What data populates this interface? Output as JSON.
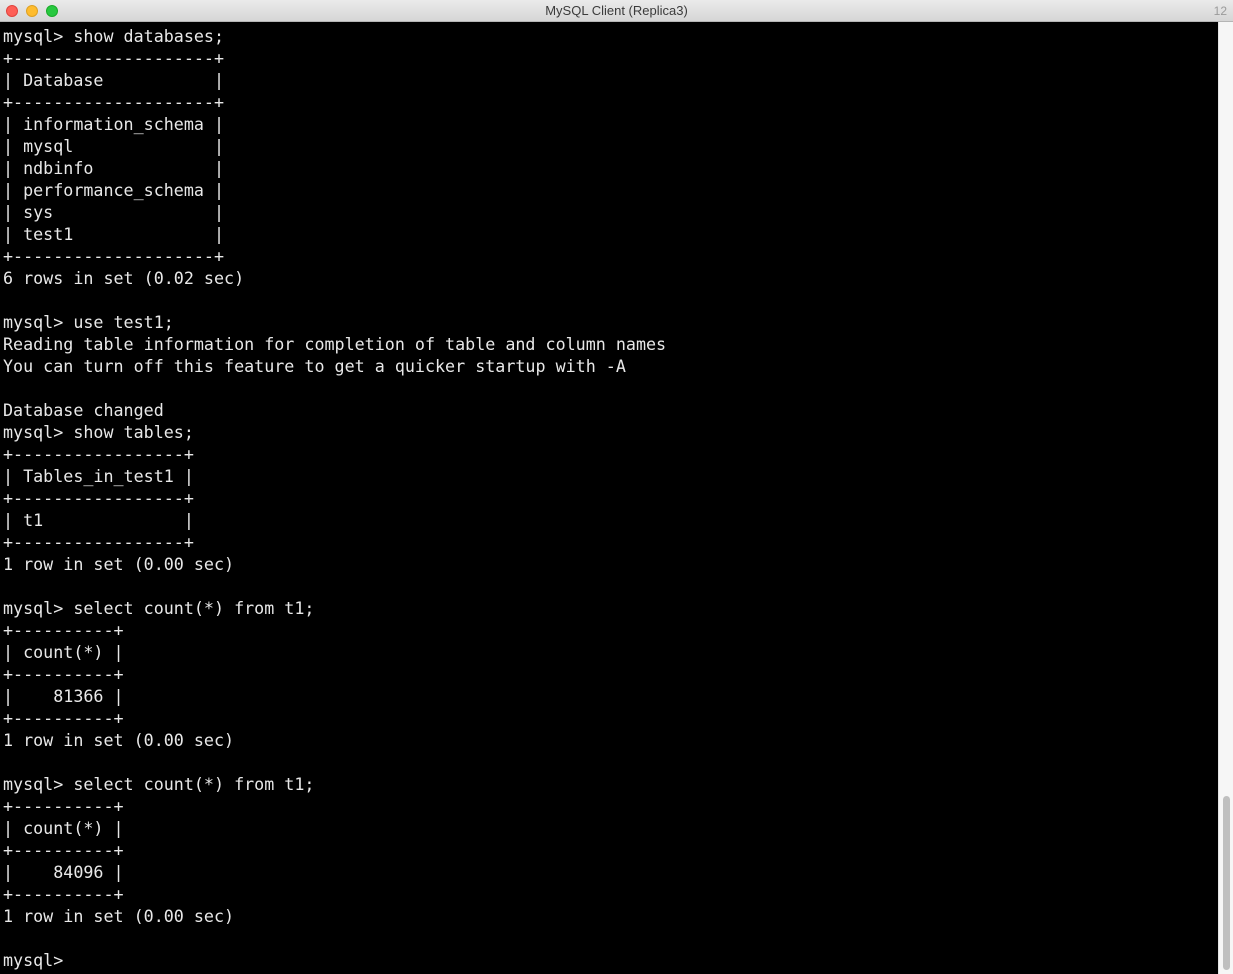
{
  "window": {
    "title": "MySQL Client (Replica3)",
    "tab_count": "12"
  },
  "terminal": {
    "lines": [
      "mysql> show databases;",
      "+--------------------+",
      "| Database           |",
      "+--------------------+",
      "| information_schema |",
      "| mysql              |",
      "| ndbinfo            |",
      "| performance_schema |",
      "| sys                |",
      "| test1              |",
      "+--------------------+",
      "6 rows in set (0.02 sec)",
      "",
      "mysql> use test1;",
      "Reading table information for completion of table and column names",
      "You can turn off this feature to get a quicker startup with -A",
      "",
      "Database changed",
      "mysql> show tables;",
      "+-----------------+",
      "| Tables_in_test1 |",
      "+-----------------+",
      "| t1              |",
      "+-----------------+",
      "1 row in set (0.00 sec)",
      "",
      "mysql> select count(*) from t1;",
      "+----------+",
      "| count(*) |",
      "+----------+",
      "|    81366 |",
      "+----------+",
      "1 row in set (0.00 sec)",
      "",
      "mysql> select count(*) from t1;",
      "+----------+",
      "| count(*) |",
      "+----------+",
      "|    84096 |",
      "+----------+",
      "1 row in set (0.00 sec)",
      "",
      "mysql> "
    ]
  },
  "colors": {
    "background": "#000000",
    "foreground": "#e8e8e8",
    "close": "#fe5f57",
    "minimize": "#febc2e",
    "maximize": "#28c840"
  }
}
